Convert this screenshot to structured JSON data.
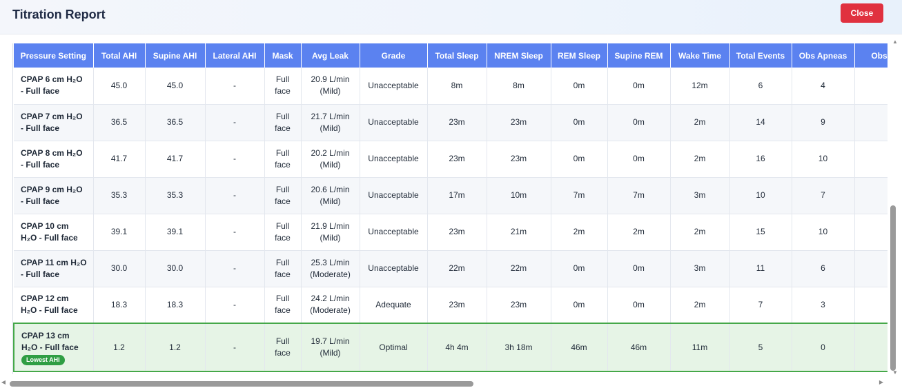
{
  "header": {
    "title": "Titration Report",
    "close_label": "Close"
  },
  "table": {
    "columns": [
      "Pressure Setting",
      "Total AHI",
      "Supine AHI",
      "Lateral AHI",
      "Mask",
      "Avg Leak",
      "Grade",
      "Total Sleep",
      "NREM Sleep",
      "REM Sleep",
      "Supine REM",
      "Wake Time",
      "Total Events",
      "Obs Apneas",
      "Obs H"
    ],
    "rows": [
      {
        "setting_line1": "CPAP 6 cm H₂O",
        "setting_line2": "- Full face",
        "total_ahi": "45.0",
        "supine_ahi": "45.0",
        "lateral_ahi": "-",
        "mask_line1": "Full",
        "mask_line2": "face",
        "leak_line1": "20.9 L/min",
        "leak_line2": "(Mild)",
        "grade": "Unacceptable",
        "total_sleep": "8m",
        "nrem_sleep": "8m",
        "rem_sleep": "0m",
        "supine_rem": "0m",
        "wake_time": "12m",
        "total_events": "6",
        "obs_apneas": "4",
        "obs_h": ""
      },
      {
        "setting_line1": "CPAP 7 cm H₂O",
        "setting_line2": "- Full face",
        "total_ahi": "36.5",
        "supine_ahi": "36.5",
        "lateral_ahi": "-",
        "mask_line1": "Full",
        "mask_line2": "face",
        "leak_line1": "21.7 L/min",
        "leak_line2": "(Mild)",
        "grade": "Unacceptable",
        "total_sleep": "23m",
        "nrem_sleep": "23m",
        "rem_sleep": "0m",
        "supine_rem": "0m",
        "wake_time": "2m",
        "total_events": "14",
        "obs_apneas": "9",
        "obs_h": ""
      },
      {
        "setting_line1": "CPAP 8 cm H₂O",
        "setting_line2": "- Full face",
        "total_ahi": "41.7",
        "supine_ahi": "41.7",
        "lateral_ahi": "-",
        "mask_line1": "Full",
        "mask_line2": "face",
        "leak_line1": "20.2 L/min",
        "leak_line2": "(Mild)",
        "grade": "Unacceptable",
        "total_sleep": "23m",
        "nrem_sleep": "23m",
        "rem_sleep": "0m",
        "supine_rem": "0m",
        "wake_time": "2m",
        "total_events": "16",
        "obs_apneas": "10",
        "obs_h": ""
      },
      {
        "setting_line1": "CPAP 9 cm H₂O",
        "setting_line2": "- Full face",
        "total_ahi": "35.3",
        "supine_ahi": "35.3",
        "lateral_ahi": "-",
        "mask_line1": "Full",
        "mask_line2": "face",
        "leak_line1": "20.6 L/min",
        "leak_line2": "(Mild)",
        "grade": "Unacceptable",
        "total_sleep": "17m",
        "nrem_sleep": "10m",
        "rem_sleep": "7m",
        "supine_rem": "7m",
        "wake_time": "3m",
        "total_events": "10",
        "obs_apneas": "7",
        "obs_h": ""
      },
      {
        "setting_line1": "CPAP 10 cm",
        "setting_line2": "H₂O - Full face",
        "total_ahi": "39.1",
        "supine_ahi": "39.1",
        "lateral_ahi": "-",
        "mask_line1": "Full",
        "mask_line2": "face",
        "leak_line1": "21.9 L/min",
        "leak_line2": "(Mild)",
        "grade": "Unacceptable",
        "total_sleep": "23m",
        "nrem_sleep": "21m",
        "rem_sleep": "2m",
        "supine_rem": "2m",
        "wake_time": "2m",
        "total_events": "15",
        "obs_apneas": "10",
        "obs_h": ""
      },
      {
        "setting_line1": "CPAP 11 cm H₂O",
        "setting_line2": "- Full face",
        "total_ahi": "30.0",
        "supine_ahi": "30.0",
        "lateral_ahi": "-",
        "mask_line1": "Full",
        "mask_line2": "face",
        "leak_line1": "25.3 L/min",
        "leak_line2": "(Moderate)",
        "grade": "Unacceptable",
        "total_sleep": "22m",
        "nrem_sleep": "22m",
        "rem_sleep": "0m",
        "supine_rem": "0m",
        "wake_time": "3m",
        "total_events": "11",
        "obs_apneas": "6",
        "obs_h": ""
      },
      {
        "setting_line1": "CPAP 12 cm",
        "setting_line2": "H₂O - Full face",
        "total_ahi": "18.3",
        "supine_ahi": "18.3",
        "lateral_ahi": "-",
        "mask_line1": "Full",
        "mask_line2": "face",
        "leak_line1": "24.2 L/min",
        "leak_line2": "(Moderate)",
        "grade": "Adequate",
        "total_sleep": "23m",
        "nrem_sleep": "23m",
        "rem_sleep": "0m",
        "supine_rem": "0m",
        "wake_time": "2m",
        "total_events": "7",
        "obs_apneas": "3",
        "obs_h": ""
      },
      {
        "setting_line1": "CPAP 13 cm",
        "setting_line2": "H₂O - Full face",
        "badge": "Lowest AHI",
        "total_ahi": "1.2",
        "supine_ahi": "1.2",
        "lateral_ahi": "-",
        "mask_line1": "Full",
        "mask_line2": "face",
        "leak_line1": "19.7 L/min",
        "leak_line2": "(Mild)",
        "grade": "Optimal",
        "total_sleep": "4h 4m",
        "nrem_sleep": "3h 18m",
        "rem_sleep": "46m",
        "supine_rem": "46m",
        "wake_time": "11m",
        "total_events": "5",
        "obs_apneas": "0",
        "obs_h": ""
      }
    ]
  },
  "colors": {
    "header_bg": "#5b82f0",
    "close_bg": "#e0313f",
    "optimal_bg": "#e6f4e6",
    "optimal_border": "#45a849",
    "badge_bg": "#2f9e44"
  },
  "scrollbars": {
    "horizontal_position": 0.0,
    "vertical_position": 1.0
  }
}
